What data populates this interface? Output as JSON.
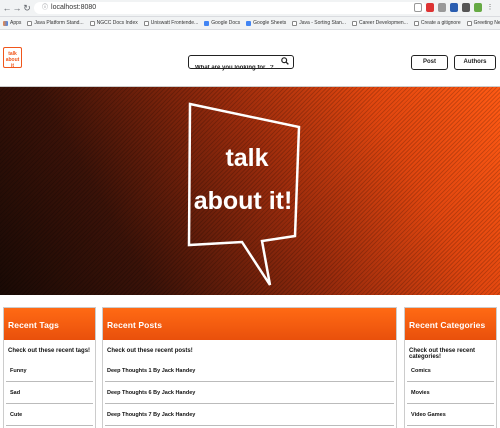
{
  "browser": {
    "url": "localhost:8080",
    "bookmarks": [
      {
        "label": "Apps",
        "icon": "apps-icon"
      },
      {
        "label": "Java Platform Stand...",
        "icon": "page-icon"
      },
      {
        "label": "NGCC Docs Index",
        "icon": "page-icon"
      },
      {
        "label": "Uniswatt Frontende...",
        "icon": "page-icon"
      },
      {
        "label": "Google Docs",
        "icon": "google-icon"
      },
      {
        "label": "Google Sheets",
        "icon": "google-icon"
      },
      {
        "label": "Java - Sorting Stan...",
        "icon": "page-icon"
      },
      {
        "label": "Career Developmen...",
        "icon": "page-icon"
      },
      {
        "label": "Create a gitignore",
        "icon": "page-icon"
      },
      {
        "label": "Greeting New Grad...",
        "icon": "page-icon"
      },
      {
        "label": "Getting the Java L...",
        "icon": "page-icon"
      }
    ]
  },
  "header": {
    "logo_text": "talk about it",
    "search_placeholder": "What are you looking for...?",
    "buttons": [
      "Post",
      "Authors"
    ]
  },
  "hero": {
    "bubble_line1": "talk",
    "bubble_line2": "about it!"
  },
  "colors": {
    "accent": "#f0561b",
    "header_orange": "#ff6a14",
    "hero_dark": "#1a0a05"
  },
  "recent_tags": {
    "title": "Recent Tags",
    "subtitle": "Check out these recent tags!",
    "items": [
      "Funny",
      "Sad",
      "Cute"
    ]
  },
  "recent_posts": {
    "title": "Recent Posts",
    "subtitle": "Check out these recent posts!",
    "items": [
      "Deep Thoughts 1 By Jack Handey",
      "Deep Thoughts 6 By Jack Handey",
      "Deep Thoughts 7 By Jack Handey"
    ]
  },
  "recent_categories": {
    "title": "Recent Categories",
    "subtitle": "Check out these recent categories!",
    "items": [
      "Comics",
      "Movies",
      "Video Games"
    ]
  }
}
